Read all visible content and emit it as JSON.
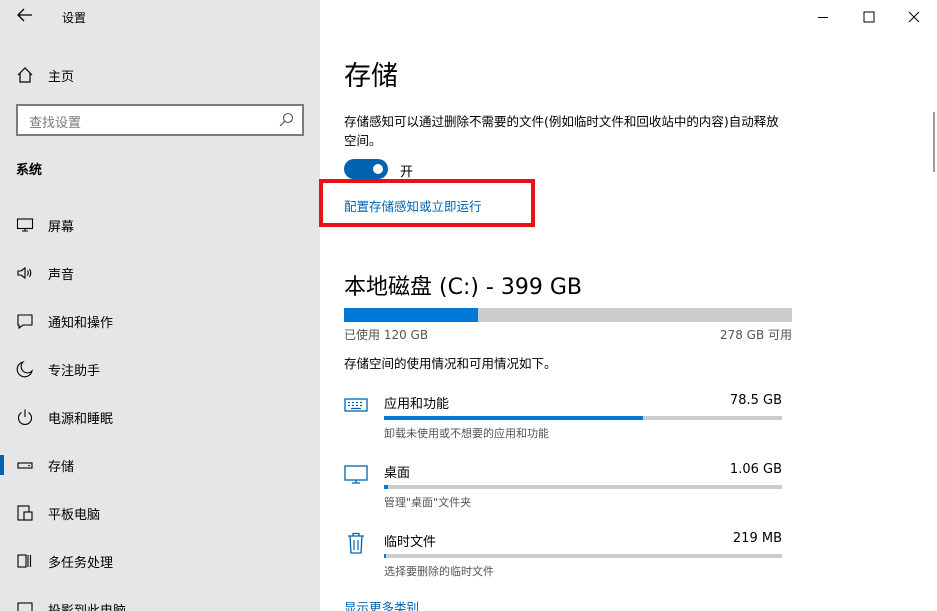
{
  "window": {
    "title": "设置",
    "controls": [
      "minimize-icon",
      "maximize-icon",
      "close-icon"
    ]
  },
  "sidebar": {
    "home_label": "主页",
    "search_placeholder": "查找设置",
    "section_title": "系统",
    "items": [
      {
        "label": "屏幕",
        "icon": "display-icon"
      },
      {
        "label": "声音",
        "icon": "speaker-icon"
      },
      {
        "label": "通知和操作",
        "icon": "notification-icon"
      },
      {
        "label": "专注助手",
        "icon": "moon-icon"
      },
      {
        "label": "电源和睡眠",
        "icon": "power-icon"
      },
      {
        "label": "存储",
        "icon": "storage-icon",
        "active": true
      },
      {
        "label": "平板电脑",
        "icon": "tablet-icon"
      },
      {
        "label": "多任务处理",
        "icon": "multitask-icon"
      },
      {
        "label": "投影到此电脑",
        "icon": "project-icon"
      }
    ]
  },
  "main": {
    "title": "存储",
    "description": "存储感知可以通过删除不需要的文件(例如临时文件和回收站中的内容)自动释放空间。",
    "toggle_state": "开",
    "config_link": "配置存储感知或立即运行",
    "accent_color": "#0078d7",
    "highlight_color": "#e8101a",
    "disk": {
      "title": "本地磁盘 (C:) - 399 GB",
      "used_label": "已使用 120 GB",
      "free_label": "278 GB 可用",
      "used_fraction": 0.3
    },
    "usage_desc": "存储空间的使用情况和可用情况如下。",
    "categories": [
      {
        "name": "应用和功能",
        "size": "78.5 GB",
        "sub": "卸载未使用或不想要的应用和功能",
        "icon": "keyboard-icon",
        "fraction": 0.65
      },
      {
        "name": "桌面",
        "size": "1.06 GB",
        "sub": "管理\"桌面\"文件夹",
        "icon": "monitor-icon",
        "fraction": 0.009
      },
      {
        "name": "临时文件",
        "size": "219 MB",
        "sub": "选择要删除的临时文件",
        "icon": "trash-icon",
        "fraction": 0.003
      }
    ],
    "more_link": "显示更多类别"
  }
}
